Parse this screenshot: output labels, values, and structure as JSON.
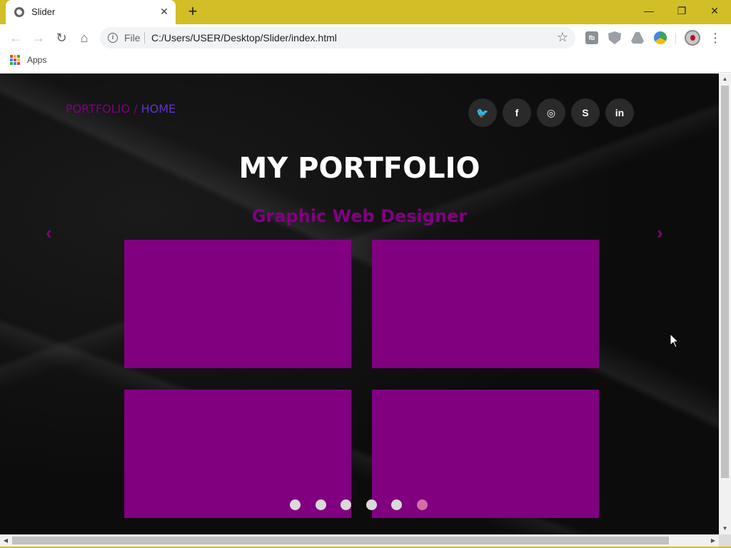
{
  "browser": {
    "tab_title": "Slider",
    "tab_close": "✕",
    "new_tab": "+",
    "window_minimize": "—",
    "window_restore": "❐",
    "window_close": "✕",
    "nav_back": "←",
    "nav_forward": "→",
    "nav_reload": "↻",
    "nav_home": "⌂",
    "omnibox_scheme": "File",
    "omnibox_url": "C:/Users/USER/Desktop/Slider/index.html",
    "bookmark_star": "☆",
    "menu": "⋮",
    "ext1_label": "fb",
    "apps_label": "Apps",
    "apps_colors": [
      "#ea4335",
      "#fbbc05",
      "#34a853",
      "#4285f4",
      "#ea4335",
      "#fbbc05",
      "#34a853",
      "#4285f4",
      "#ea4335"
    ],
    "accent_color": "#d2be27"
  },
  "page": {
    "breadcrumb_portfolio": "PORTFOLIO /",
    "breadcrumb_home": "HOME",
    "title": "MY PORTFOLIO",
    "subtitle": "Graphic Web Designer",
    "arrow_prev": "‹",
    "arrow_next": "›",
    "socials": [
      {
        "icon": "twitter-icon",
        "glyph": "🐦"
      },
      {
        "icon": "facebook-icon",
        "glyph": "f"
      },
      {
        "icon": "instagram-icon",
        "glyph": "◎"
      },
      {
        "icon": "skype-icon",
        "glyph": "S"
      },
      {
        "icon": "linkedin-icon",
        "glyph": "in"
      }
    ],
    "card_color": "#800080",
    "card_count": 4,
    "dots_count": 6,
    "active_dot": 6
  }
}
